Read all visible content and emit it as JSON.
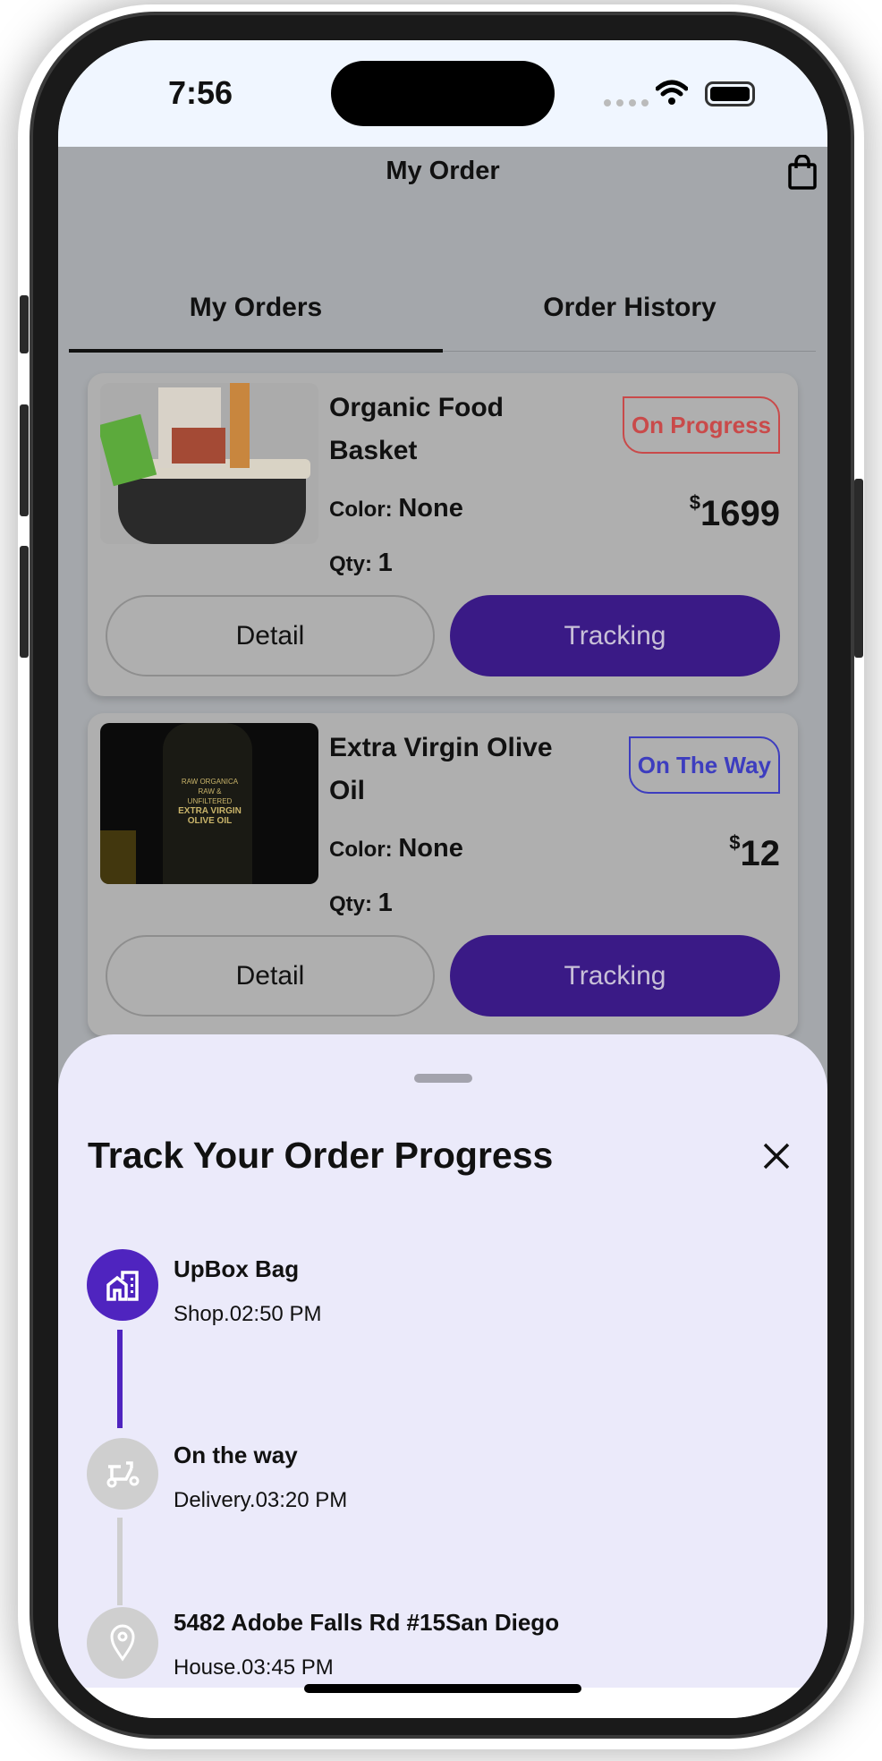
{
  "status_bar": {
    "time": "7:56"
  },
  "header": {
    "title": "My Order",
    "cart_icon": "shopping-bag-icon"
  },
  "tabs": [
    {
      "label": "My Orders",
      "active": true
    },
    {
      "label": "Order History",
      "active": false
    }
  ],
  "orders": [
    {
      "name": "Organic Food Basket",
      "status": "On Progress",
      "status_color": "#c94a4a",
      "color_label": "Color:",
      "color_value": "None",
      "qty_label": "Qty:",
      "qty_value": "1",
      "currency": "$",
      "price": "1699",
      "detail_label": "Detail",
      "tracking_label": "Tracking"
    },
    {
      "name": "Extra Virgin Olive Oil",
      "status": "On The Way",
      "status_color": "#3d3dbf",
      "color_label": "Color:",
      "color_value": "None",
      "qty_label": "Qty:",
      "qty_value": "1",
      "currency": "$",
      "price": "12",
      "detail_label": "Detail",
      "tracking_label": "Tracking",
      "image_text": "RAW ORGANICA · RAW & UNFILTERED · EXTRA VIRGIN OLIVE OIL"
    }
  ],
  "tracking_sheet": {
    "title": "Track Your Order Progress",
    "close_icon": "close-icon",
    "accent": "#4f24bf",
    "steps": [
      {
        "name": "UpBox Bag",
        "sub": "Shop.02:50 PM",
        "icon": "building-icon",
        "done": true
      },
      {
        "name": "On the way",
        "sub": "Delivery.03:20 PM",
        "icon": "scooter-icon",
        "done": false
      },
      {
        "name": "5482 Adobe Falls Rd #15San Diego",
        "sub": "House.03:45 PM",
        "icon": "location-pin-icon",
        "done": false
      }
    ]
  }
}
